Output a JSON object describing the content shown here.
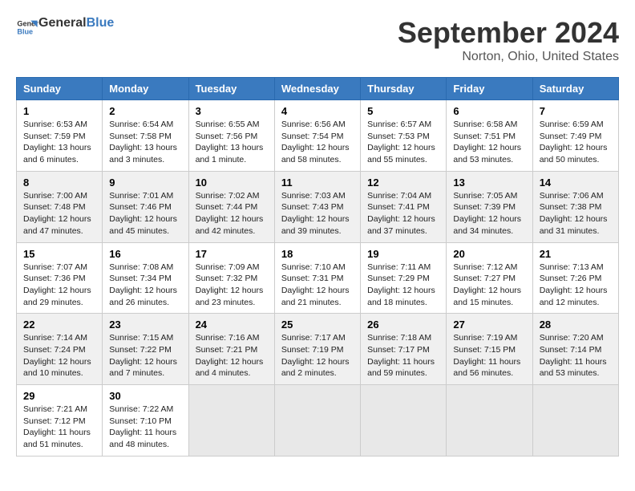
{
  "header": {
    "logo_line1": "General",
    "logo_line2": "Blue",
    "month": "September 2024",
    "location": "Norton, Ohio, United States"
  },
  "weekdays": [
    "Sunday",
    "Monday",
    "Tuesday",
    "Wednesday",
    "Thursday",
    "Friday",
    "Saturday"
  ],
  "weeks": [
    [
      {
        "day": "1",
        "info": "Sunrise: 6:53 AM\nSunset: 7:59 PM\nDaylight: 13 hours\nand 6 minutes."
      },
      {
        "day": "2",
        "info": "Sunrise: 6:54 AM\nSunset: 7:58 PM\nDaylight: 13 hours\nand 3 minutes."
      },
      {
        "day": "3",
        "info": "Sunrise: 6:55 AM\nSunset: 7:56 PM\nDaylight: 13 hours\nand 1 minute."
      },
      {
        "day": "4",
        "info": "Sunrise: 6:56 AM\nSunset: 7:54 PM\nDaylight: 12 hours\nand 58 minutes."
      },
      {
        "day": "5",
        "info": "Sunrise: 6:57 AM\nSunset: 7:53 PM\nDaylight: 12 hours\nand 55 minutes."
      },
      {
        "day": "6",
        "info": "Sunrise: 6:58 AM\nSunset: 7:51 PM\nDaylight: 12 hours\nand 53 minutes."
      },
      {
        "day": "7",
        "info": "Sunrise: 6:59 AM\nSunset: 7:49 PM\nDaylight: 12 hours\nand 50 minutes."
      }
    ],
    [
      {
        "day": "8",
        "info": "Sunrise: 7:00 AM\nSunset: 7:48 PM\nDaylight: 12 hours\nand 47 minutes."
      },
      {
        "day": "9",
        "info": "Sunrise: 7:01 AM\nSunset: 7:46 PM\nDaylight: 12 hours\nand 45 minutes."
      },
      {
        "day": "10",
        "info": "Sunrise: 7:02 AM\nSunset: 7:44 PM\nDaylight: 12 hours\nand 42 minutes."
      },
      {
        "day": "11",
        "info": "Sunrise: 7:03 AM\nSunset: 7:43 PM\nDaylight: 12 hours\nand 39 minutes."
      },
      {
        "day": "12",
        "info": "Sunrise: 7:04 AM\nSunset: 7:41 PM\nDaylight: 12 hours\nand 37 minutes."
      },
      {
        "day": "13",
        "info": "Sunrise: 7:05 AM\nSunset: 7:39 PM\nDaylight: 12 hours\nand 34 minutes."
      },
      {
        "day": "14",
        "info": "Sunrise: 7:06 AM\nSunset: 7:38 PM\nDaylight: 12 hours\nand 31 minutes."
      }
    ],
    [
      {
        "day": "15",
        "info": "Sunrise: 7:07 AM\nSunset: 7:36 PM\nDaylight: 12 hours\nand 29 minutes."
      },
      {
        "day": "16",
        "info": "Sunrise: 7:08 AM\nSunset: 7:34 PM\nDaylight: 12 hours\nand 26 minutes."
      },
      {
        "day": "17",
        "info": "Sunrise: 7:09 AM\nSunset: 7:32 PM\nDaylight: 12 hours\nand 23 minutes."
      },
      {
        "day": "18",
        "info": "Sunrise: 7:10 AM\nSunset: 7:31 PM\nDaylight: 12 hours\nand 21 minutes."
      },
      {
        "day": "19",
        "info": "Sunrise: 7:11 AM\nSunset: 7:29 PM\nDaylight: 12 hours\nand 18 minutes."
      },
      {
        "day": "20",
        "info": "Sunrise: 7:12 AM\nSunset: 7:27 PM\nDaylight: 12 hours\nand 15 minutes."
      },
      {
        "day": "21",
        "info": "Sunrise: 7:13 AM\nSunset: 7:26 PM\nDaylight: 12 hours\nand 12 minutes."
      }
    ],
    [
      {
        "day": "22",
        "info": "Sunrise: 7:14 AM\nSunset: 7:24 PM\nDaylight: 12 hours\nand 10 minutes."
      },
      {
        "day": "23",
        "info": "Sunrise: 7:15 AM\nSunset: 7:22 PM\nDaylight: 12 hours\nand 7 minutes."
      },
      {
        "day": "24",
        "info": "Sunrise: 7:16 AM\nSunset: 7:21 PM\nDaylight: 12 hours\nand 4 minutes."
      },
      {
        "day": "25",
        "info": "Sunrise: 7:17 AM\nSunset: 7:19 PM\nDaylight: 12 hours\nand 2 minutes."
      },
      {
        "day": "26",
        "info": "Sunrise: 7:18 AM\nSunset: 7:17 PM\nDaylight: 11 hours\nand 59 minutes."
      },
      {
        "day": "27",
        "info": "Sunrise: 7:19 AM\nSunset: 7:15 PM\nDaylight: 11 hours\nand 56 minutes."
      },
      {
        "day": "28",
        "info": "Sunrise: 7:20 AM\nSunset: 7:14 PM\nDaylight: 11 hours\nand 53 minutes."
      }
    ],
    [
      {
        "day": "29",
        "info": "Sunrise: 7:21 AM\nSunset: 7:12 PM\nDaylight: 11 hours\nand 51 minutes."
      },
      {
        "day": "30",
        "info": "Sunrise: 7:22 AM\nSunset: 7:10 PM\nDaylight: 11 hours\nand 48 minutes."
      },
      {
        "day": "",
        "info": ""
      },
      {
        "day": "",
        "info": ""
      },
      {
        "day": "",
        "info": ""
      },
      {
        "day": "",
        "info": ""
      },
      {
        "day": "",
        "info": ""
      }
    ]
  ]
}
